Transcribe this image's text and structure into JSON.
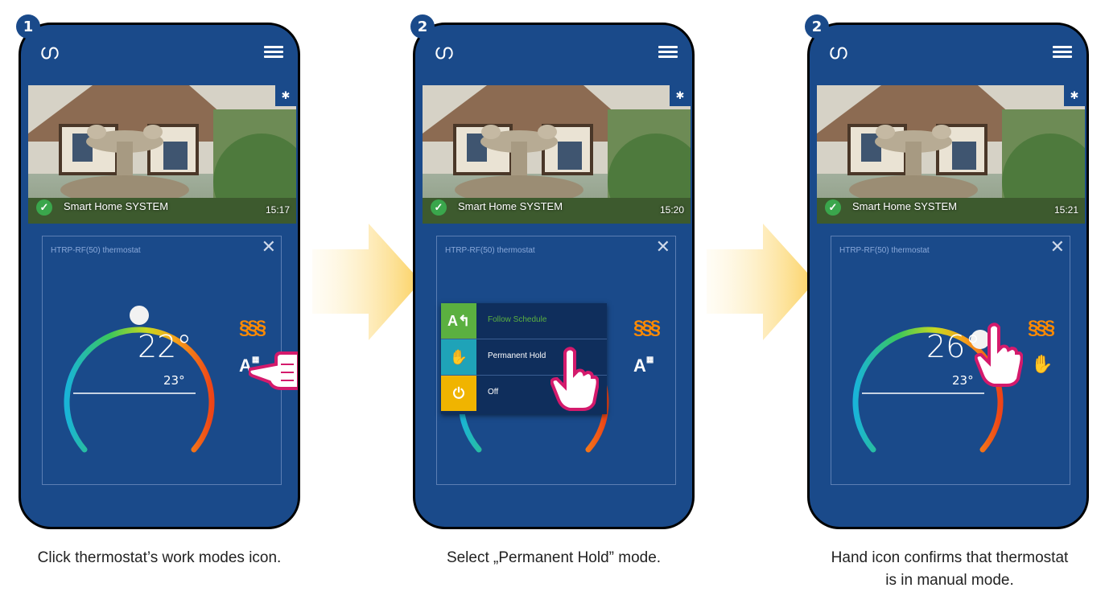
{
  "panels": [
    {
      "step": "1",
      "system_name": "Smart Home SYSTEM",
      "time": "15:17",
      "thermostat_title": "HTRP-RF(50) thermostat",
      "setpoint": "22°",
      "current": "23°",
      "caption": "Click thermostat’s work modes icon."
    },
    {
      "step": "2",
      "system_name": "Smart Home SYSTEM",
      "time": "15:20",
      "thermostat_title": "HTRP-RF(50) thermostat",
      "menu": {
        "follow_schedule": "Follow Schedule",
        "permanent_hold": "Permanent Hold",
        "off": "Off"
      },
      "caption": "Select „Permanent Hold” mode."
    },
    {
      "step": "2",
      "system_name": "Smart Home SYSTEM",
      "time": "15:21",
      "thermostat_title": "HTRP-RF(50) thermostat",
      "setpoint": "26°",
      "current": "23°",
      "caption_line1": "Hand icon confirms that thermostat",
      "caption_line2": "is in manual mode."
    }
  ],
  "colors": {
    "app_bg": "#1a4a8a",
    "heat": "#ff8a00",
    "follow_green": "#5bb040",
    "hold_teal": "#1fa3b8",
    "off_yellow": "#f0b400",
    "arrow": "#fbd160"
  },
  "icons": {
    "logo": "salus-logo-icon",
    "menu": "hamburger-menu-icon",
    "settings": "gear-icon",
    "status": "check-icon",
    "close": "close-icon",
    "heating": "heating-waves-icon",
    "auto_schedule": "auto-schedule-icon",
    "manual": "hand-icon",
    "pointer": "tapping-hand-icon"
  }
}
